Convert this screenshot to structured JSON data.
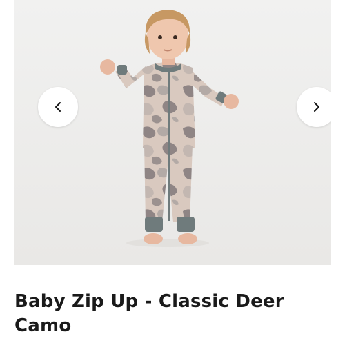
{
  "product": {
    "title": "Baby Zip Up - Classic Deer Camo"
  },
  "gallery": {
    "prev_icon": "chevron-left-icon",
    "next_icon": "chevron-right-icon",
    "background_color": "#f1f1f0"
  }
}
